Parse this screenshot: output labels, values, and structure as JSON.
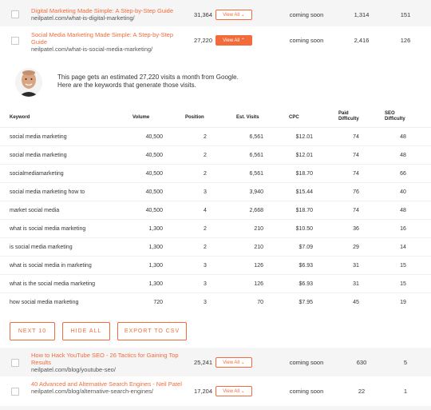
{
  "rows_top": [
    {
      "title": "Digital Marketing Made Simple: A Step-by-Step Guide",
      "url": "neilpatel.com/what-is-digital-marketing/",
      "visits": "31,364",
      "button": "View All ⌄",
      "status": "coming soon",
      "n1": "1,314",
      "n2": "151"
    },
    {
      "title": "Social Media Marketing Made Simple: A Step-by-Step Guide",
      "url": "neilpatel.com/what-is-social-media-marketing/",
      "visits": "27,220",
      "button": "View All ⌃",
      "status": "coming soon",
      "n1": "2,416",
      "n2": "126"
    }
  ],
  "intro": {
    "line1": "This page gets an estimated 27,220 visits a month from Google.",
    "line2": "Here are the keywords that generate those visits."
  },
  "table": {
    "headers": {
      "keyword": "Keyword",
      "volume": "Volume",
      "position": "Position",
      "est_visits": "Est. Visits",
      "cpc": "CPC",
      "paid_difficulty": "Paid Difficulty",
      "seo_difficulty": "SEO Difficulty"
    },
    "rows": [
      {
        "keyword": "social media marketing",
        "volume": "40,500",
        "position": "2",
        "est": "6,561",
        "cpc": "$12.01",
        "pd": "74",
        "sd": "48"
      },
      {
        "keyword": "social media marketing",
        "volume": "40,500",
        "position": "2",
        "est": "6,561",
        "cpc": "$12.01",
        "pd": "74",
        "sd": "48"
      },
      {
        "keyword": "socialmediamarketing",
        "volume": "40,500",
        "position": "2",
        "est": "6,561",
        "cpc": "$18.70",
        "pd": "74",
        "sd": "66"
      },
      {
        "keyword": "social media marketing how to",
        "volume": "40,500",
        "position": "3",
        "est": "3,940",
        "cpc": "$15.44",
        "pd": "76",
        "sd": "40"
      },
      {
        "keyword": "market social media",
        "volume": "40,500",
        "position": "4",
        "est": "2,668",
        "cpc": "$18.70",
        "pd": "74",
        "sd": "48"
      },
      {
        "keyword": "what is social media marketing",
        "volume": "1,300",
        "position": "2",
        "est": "210",
        "cpc": "$10.50",
        "pd": "36",
        "sd": "16"
      },
      {
        "keyword": "is social media marketing",
        "volume": "1,300",
        "position": "2",
        "est": "210",
        "cpc": "$7.09",
        "pd": "29",
        "sd": "14"
      },
      {
        "keyword": "what is social media in marketing",
        "volume": "1,300",
        "position": "3",
        "est": "126",
        "cpc": "$6.93",
        "pd": "31",
        "sd": "15"
      },
      {
        "keyword": "what is the social media marketing",
        "volume": "1,300",
        "position": "3",
        "est": "126",
        "cpc": "$6.93",
        "pd": "31",
        "sd": "15"
      },
      {
        "keyword": "how social media marketing",
        "volume": "720",
        "position": "3",
        "est": "70",
        "cpc": "$7.95",
        "pd": "45",
        "sd": "19"
      }
    ]
  },
  "actions": {
    "next": "NEXT 10",
    "hide": "HIDE ALL",
    "export": "EXPORT TO CSV"
  },
  "rows_bottom": [
    {
      "title": "How to Hack YouTube SEO - 26 Tactics for Gaining Top Results",
      "url": "neilpatel.com/blog/youtube-seo/",
      "visits": "25,241",
      "button": "View All ⌄",
      "status": "coming soon",
      "n1": "630",
      "n2": "5"
    },
    {
      "title": "40 Advanced and Alternative Search Engines - Neil Patel",
      "url": "neilpatel.com/blog/alternative-search-engines/",
      "visits": "17,204",
      "button": "View All ⌄",
      "status": "coming soon",
      "n1": "22",
      "n2": "1"
    }
  ],
  "colors": {
    "accent": "#f26b3a",
    "row_shade": "#f5f5f5"
  }
}
